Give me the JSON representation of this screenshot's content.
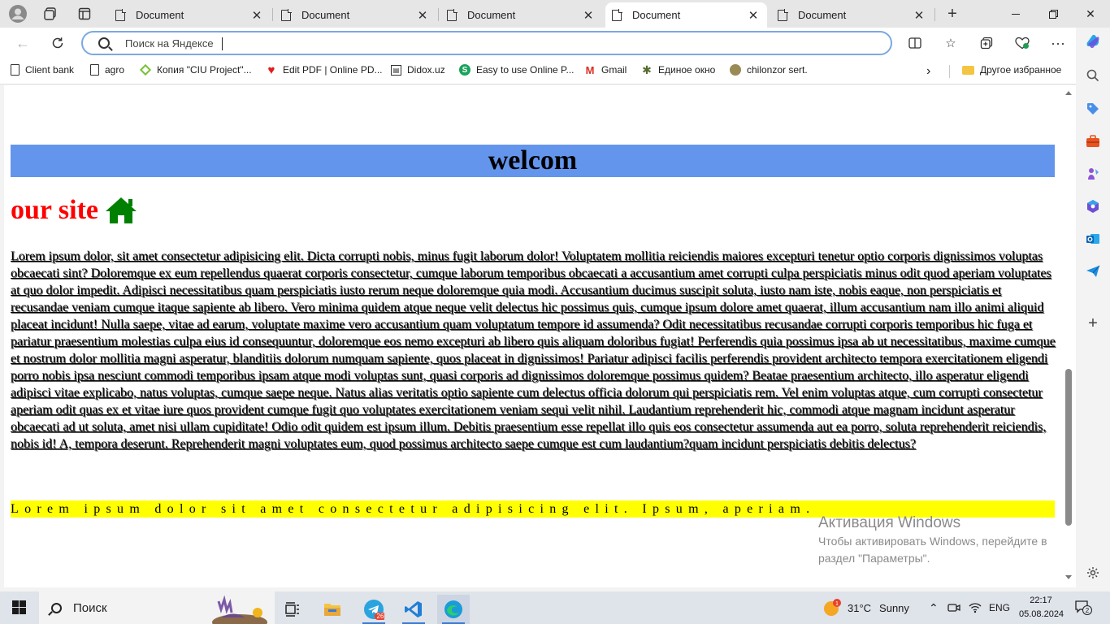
{
  "tabs": [
    {
      "label": "Document",
      "active": false
    },
    {
      "label": "Document",
      "active": false
    },
    {
      "label": "Document",
      "active": false
    },
    {
      "label": "Document",
      "active": true
    },
    {
      "label": "Document",
      "active": false
    }
  ],
  "address_bar": {
    "placeholder": "Поиск на Яндексе",
    "value": ""
  },
  "bookmarks": [
    {
      "label": "Client bank",
      "icon": "doc-icon"
    },
    {
      "label": "agro",
      "icon": "doc-icon"
    },
    {
      "label": "Копия \"CIU Project\"...",
      "icon": "diamond-icon"
    },
    {
      "label": "Edit PDF | Online PD...",
      "icon": "heart-icon"
    },
    {
      "label": "Didox.uz",
      "icon": "didox-icon"
    },
    {
      "label": "Easy to use Online P...",
      "icon": "s-circle-icon"
    },
    {
      "label": "Gmail",
      "icon": "gmail-icon"
    },
    {
      "label": "Единое окно",
      "icon": "gear-icon"
    },
    {
      "label": "chilonzor sert.",
      "icon": "coin-icon"
    }
  ],
  "other_favorites": "Другое избранное",
  "page": {
    "hero_text": "welcom",
    "site_title": "our site",
    "paragraph": "Lorem ipsum dolor, sit amet consectetur adipisicing elit. Dicta corrupti nobis, minus fugit laborum dolor! Voluptatem mollitia reiciendis maiores excepturi tenetur optio corporis dignissimos voluptas obcaecati sint? Doloremque ex eum repellendus quaerat corporis consectetur, cumque laborum temporibus obcaecati a accusantium amet corrupti culpa perspiciatis minus odit quod aperiam voluptates at quo dolor impedit. Adipisci necessitatibus quam perspiciatis iusto rerum neque doloremque quia modi. Accusantium ducimus suscipit soluta, iusto nam iste, nobis eaque, non perspiciatis et recusandae veniam cumque itaque sapiente ab libero. Vero minima quidem atque neque velit delectus hic possimus quis, cumque ipsum dolore amet quaerat, illum accusantium nam illo animi aliquid placeat incidunt! Nulla saepe, vitae ad earum, voluptate maxime vero accusantium quam voluptatum tempore id assumenda? Odit necessitatibus recusandae corrupti corporis temporibus hic fuga et pariatur praesentium molestias culpa eius id consequuntur, doloremque eos nemo excepturi ab libero quis aliquam doloribus fugiat! Perferendis quia possimus ipsa ab ut necessitatibus, maxime cumque et nostrum dolor mollitia magni asperatur, blanditiis dolorum numquam sapiente, quos placeat in dignissimos! Pariatur adipisci facilis perferendis provident architecto tempora exercitationem eligendi porro nobis ipsa nesciunt commodi temporibus ipsam atque modi voluptas sunt, quasi corporis ad dignissimos doloremque possimus quidem? Beatae praesentium architecto, illo asperatur eligendi adipisci vitae explicabo, natus voluptas, cumque saepe neque. Natus alias veritatis optio sapiente cum delectus officia dolorum qui perspiciatis rem. Vel enim voluptas atque, cum corrupti consectetur aperiam odit quas ex et vitae iure quos provident cumque fugit quo voluptates exercitationem veniam sequi velit nihil. Laudantium reprehenderit hic, commodi atque magnam incidunt asperatur obcaecati ad ut soluta, amet nisi ullam cupiditate! Odio odit quidem est ipsum illum. Debitis praesentium esse repellat illo quis eos consectetur assumenda aut ea porro, soluta reprehenderit reiciendis, nobis id! A, tempora deserunt. Reprehenderit magni voluptates eum, quod possimus architecto saepe cumque est cum laudantium?quam incidunt perspiciatis debitis delectus?",
    "yellow_text": "Lorem ipsum dolor sit amet consectetur adipisicing elit. Ipsum, aperiam."
  },
  "watermark": {
    "title": "Активация Windows",
    "line1": "Чтобы активировать Windows, перейдите в",
    "line2": "раздел \"Параметры\"."
  },
  "taskbar": {
    "search_label": "Поиск",
    "telegram_badge": "26",
    "weather_temp": "31°C",
    "weather_desc": "Sunny",
    "weather_badge": "1",
    "lang": "ENG",
    "time": "22:17",
    "date": "05.08.2024",
    "notifications": "2"
  },
  "colors": {
    "hero_bg": "#6495ed",
    "site_title": "#ff0000",
    "house_icon": "#008000",
    "highlight_bg": "#ffff00"
  }
}
